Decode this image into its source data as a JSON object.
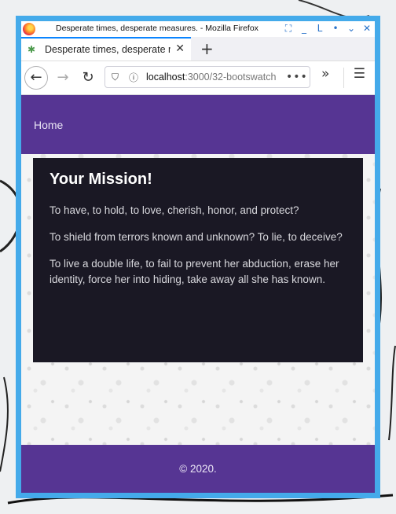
{
  "window": {
    "title": "Desperate times, desperate measures. - Mozilla Firefox",
    "controls": [
      "⛶",
      "_",
      "L",
      "•",
      "⌄",
      "✕"
    ]
  },
  "tab": {
    "title": "Desperate times, desperate measures.",
    "close": "✕",
    "new_tab": "+"
  },
  "nav": {
    "back": "←",
    "forward": "→",
    "reload": "↻",
    "url_host": "localhost",
    "url_path": ":3000/32-bootswatch",
    "url_more": "•••",
    "overflow": "»",
    "menu": "☰"
  },
  "site": {
    "nav_home": "Home",
    "mission": {
      "title": "Your Mission!",
      "paragraphs": [
        "To have, to hold, to love, cherish, honor, and protect?",
        "To shield from terrors known and unknown? To lie, to deceive?",
        "To live a double life, to fail to prevent her abduction, erase her identity, force her into hiding, take away all she has known."
      ]
    },
    "footer": "© 2020."
  },
  "colors": {
    "navbar_purple": "#563593",
    "card_dark": "#1a1824",
    "frame_blue": "#44aaea"
  }
}
